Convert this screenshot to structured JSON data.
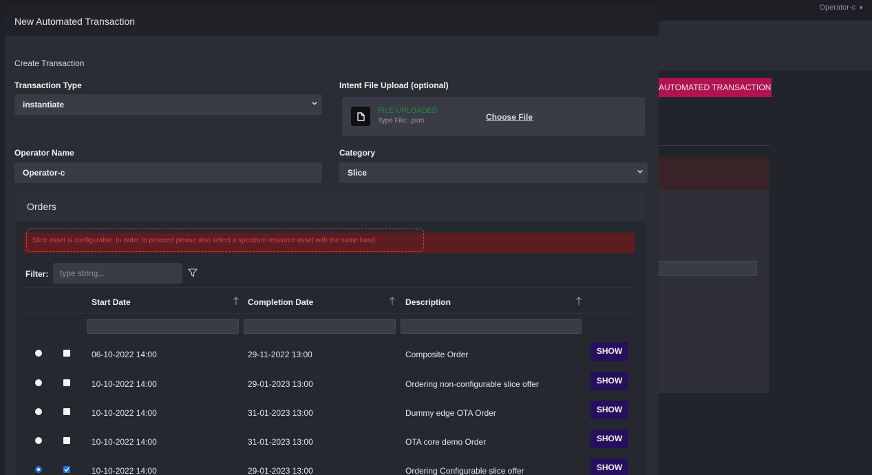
{
  "background": {
    "user_menu": "Operator-c",
    "primary_button": "AUTOMATED TRANSACTION"
  },
  "modal": {
    "title": "New Automated Transaction",
    "section_title": "Create Transaction",
    "transaction_type": {
      "label": "Transaction Type",
      "value": "instantiate"
    },
    "intent_upload": {
      "label": "Intent File Upload (optional)",
      "status": "FILE UPLOADED",
      "type_hint": "Type File: .json",
      "choose_label": "Choose File"
    },
    "operator_name": {
      "label": "Operator Name",
      "value": "Operator-c"
    },
    "category": {
      "label": "Category",
      "value": "Slice"
    },
    "orders": {
      "title": "Orders",
      "alert": "Slice asset is configurable. In order to proceed please also select a spectrum resource asset with the same band",
      "filter_label": "Filter:",
      "filter_placeholder": "type string...",
      "columns": [
        "Start Date",
        "Completion Date",
        "Description"
      ],
      "show_label": "SHOW",
      "rows": [
        {
          "start": "06-10-2022 14:00",
          "completion": "29-11-2022 13:00",
          "description": "Composite Order",
          "selected": false,
          "checked": false
        },
        {
          "start": "10-10-2022 14:00",
          "completion": "29-01-2023 13:00",
          "description": "Ordering non-configurable slice offer",
          "selected": false,
          "checked": false
        },
        {
          "start": "10-10-2022 14:00",
          "completion": "31-01-2023 13:00",
          "description": "Dummy edge OTA Order",
          "selected": false,
          "checked": false
        },
        {
          "start": "10-10-2022 14:00",
          "completion": "31-01-2023 13:00",
          "description": "OTA core demo Order",
          "selected": false,
          "checked": false
        },
        {
          "start": "10-10-2022 14:00",
          "completion": "29-01-2023 13:00",
          "description": "Ordering Configurable slice offer",
          "selected": true,
          "checked": true
        }
      ]
    }
  },
  "colors": {
    "accent": "#b0134f",
    "show_button": "#260f5c",
    "selection_blue": "#1a73e8",
    "alert_bg": "#5c1c20",
    "upload_success": "#1f8a3a"
  }
}
